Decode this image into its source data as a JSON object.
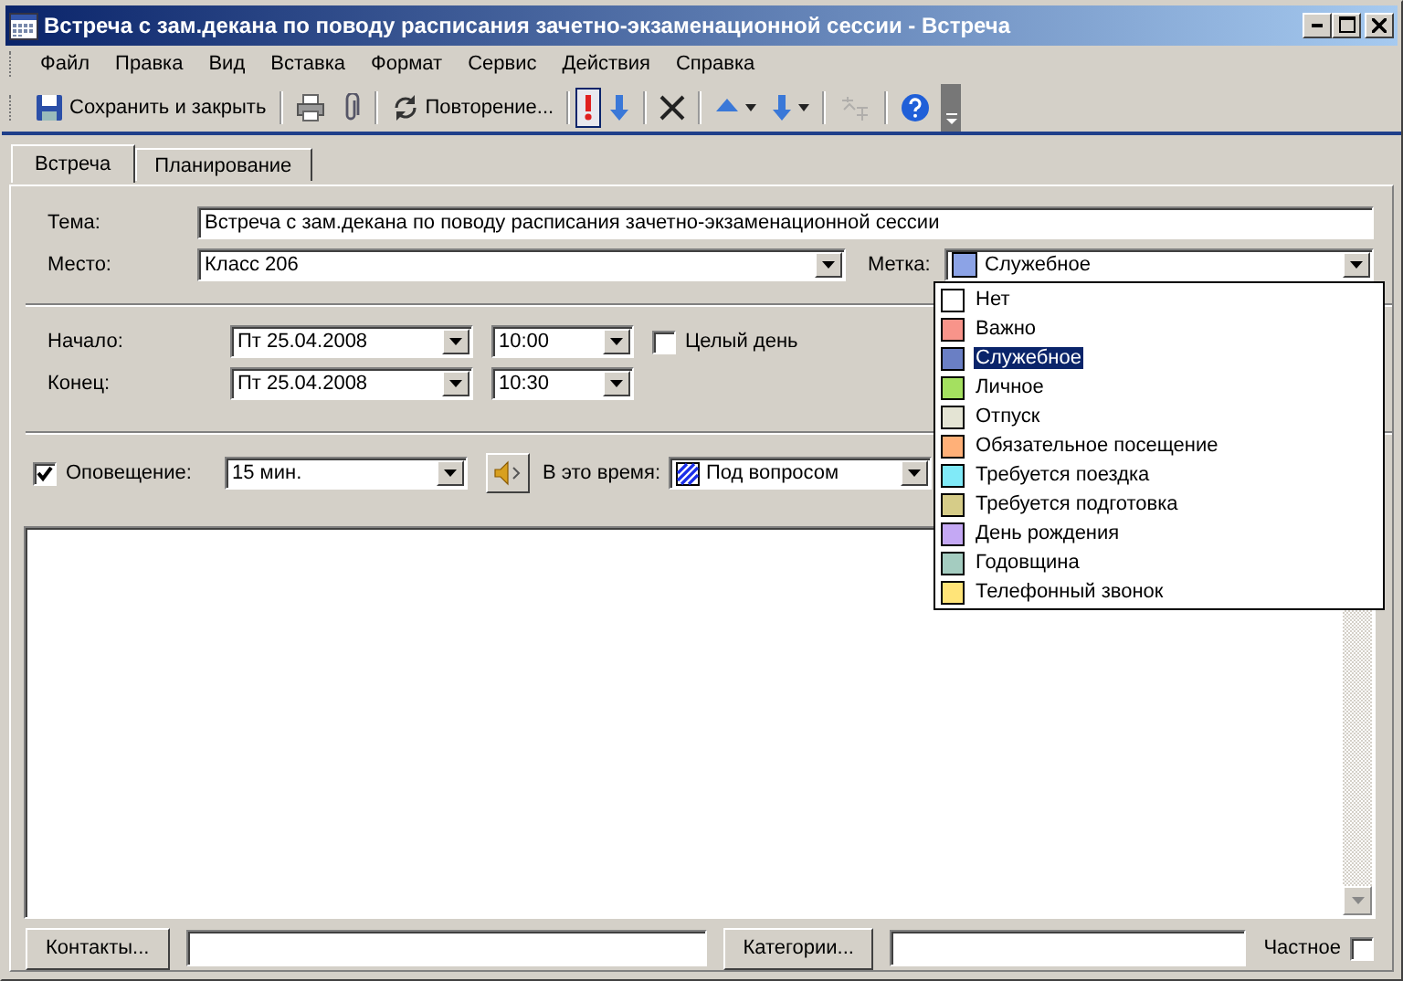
{
  "window": {
    "title": "Встреча с зам.декана по поводу расписания зачетно-экзаменационной сессии - Встреча"
  },
  "menu": [
    "Файл",
    "Правка",
    "Вид",
    "Вставка",
    "Формат",
    "Сервис",
    "Действия",
    "Справка"
  ],
  "toolbar": [
    {
      "kind": "save",
      "label": "Сохранить и закрыть"
    },
    {
      "kind": "separator"
    },
    {
      "kind": "print"
    },
    {
      "kind": "attach"
    },
    {
      "kind": "separator"
    },
    {
      "kind": "recurrence",
      "label": "Повторение..."
    },
    {
      "kind": "separator"
    },
    {
      "kind": "high",
      "selected": true
    },
    {
      "kind": "low",
      "selected": false
    },
    {
      "kind": "separator"
    },
    {
      "kind": "delete"
    },
    {
      "kind": "separator"
    },
    {
      "kind": "previous"
    },
    {
      "kind": "next"
    },
    {
      "kind": "separator"
    },
    {
      "kind": "translate",
      "disabled": true
    },
    {
      "kind": "separator"
    },
    {
      "kind": "help"
    }
  ],
  "tabs": [
    {
      "label": "Встреча",
      "selected": true
    },
    {
      "label": "Планирование",
      "selected": false
    }
  ],
  "subject": {
    "label": "Тема:",
    "value": "Встреча с зам.декана по поводу расписания зачетно-экзаменационной сессии"
  },
  "location": {
    "label": "Место:",
    "value": "Класс 206"
  },
  "tag": {
    "label": "Метка:",
    "value": "Служебное",
    "color": "#8ca3e6",
    "options": [
      {
        "label": "Нет",
        "color": "#ffffff",
        "selected": false
      },
      {
        "label": "Важно",
        "color": "#f8948a",
        "selected": false
      },
      {
        "label": "Служебное",
        "color": "#6a7fc4",
        "selected": true
      },
      {
        "label": "Личное",
        "color": "#a4e060",
        "selected": false
      },
      {
        "label": "Отпуск",
        "color": "#e4e4d4",
        "selected": false
      },
      {
        "label": "Обязательное посещение",
        "color": "#ffb078",
        "selected": false
      },
      {
        "label": "Требуется поездка",
        "color": "#80eaf8",
        "selected": false
      },
      {
        "label": "Требуется подготовка",
        "color": "#d6cc88",
        "selected": false
      },
      {
        "label": "День рождения",
        "color": "#c4a8f4",
        "selected": false
      },
      {
        "label": "Годовщина",
        "color": "#a4ccc0",
        "selected": false
      },
      {
        "label": "Телефонный звонок",
        "color": "#ffe478",
        "selected": false
      }
    ]
  },
  "start": {
    "label": "Начало:",
    "date": "Пт 25.04.2008",
    "time": "10:00"
  },
  "end": {
    "label": "Конец:",
    "date": "Пт 25.04.2008",
    "time": "10:30"
  },
  "all_day": {
    "label": "Целый день",
    "checked": false
  },
  "reminder": {
    "label": "Оповещение:",
    "checked": true,
    "value": "15 мин."
  },
  "show_as": {
    "label": "В это время:",
    "value": "Под вопросом"
  },
  "footer": {
    "contacts_button": "Контакты...",
    "categories_button": "Категории...",
    "private": {
      "label": "Частное",
      "checked": false
    }
  }
}
